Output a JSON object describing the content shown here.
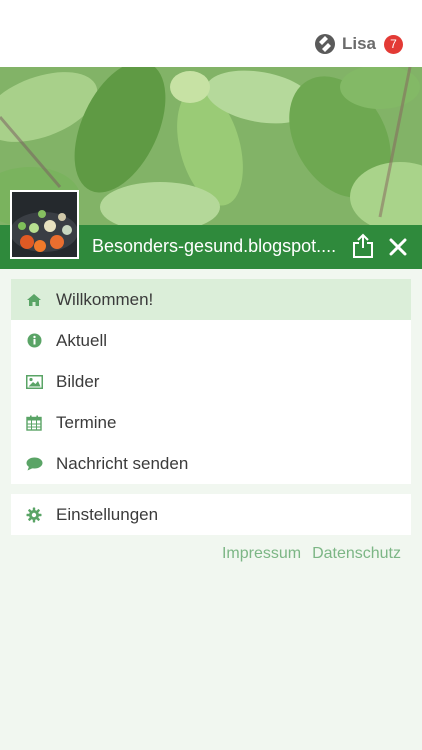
{
  "user": {
    "name": "Lisa",
    "notifications": "7"
  },
  "header": {
    "title": "Besonders-gesund.blogspot...."
  },
  "menu": {
    "items": [
      {
        "label": "Willkommen!",
        "icon": "home-icon"
      },
      {
        "label": "Aktuell",
        "icon": "info-icon"
      },
      {
        "label": "Bilder",
        "icon": "image-icon"
      },
      {
        "label": "Termine",
        "icon": "calendar-icon"
      },
      {
        "label": "Nachricht senden",
        "icon": "chat-bubble-icon"
      }
    ],
    "settings": {
      "label": "Einstellungen",
      "icon": "gear-icon"
    }
  },
  "footer": {
    "impressum": "Impressum",
    "datenschutz": "Datenschutz"
  },
  "colors": {
    "accent": "#2f8a3c",
    "icon": "#5aa466",
    "background": "#f1f7f0",
    "badge": "#e33a35"
  }
}
